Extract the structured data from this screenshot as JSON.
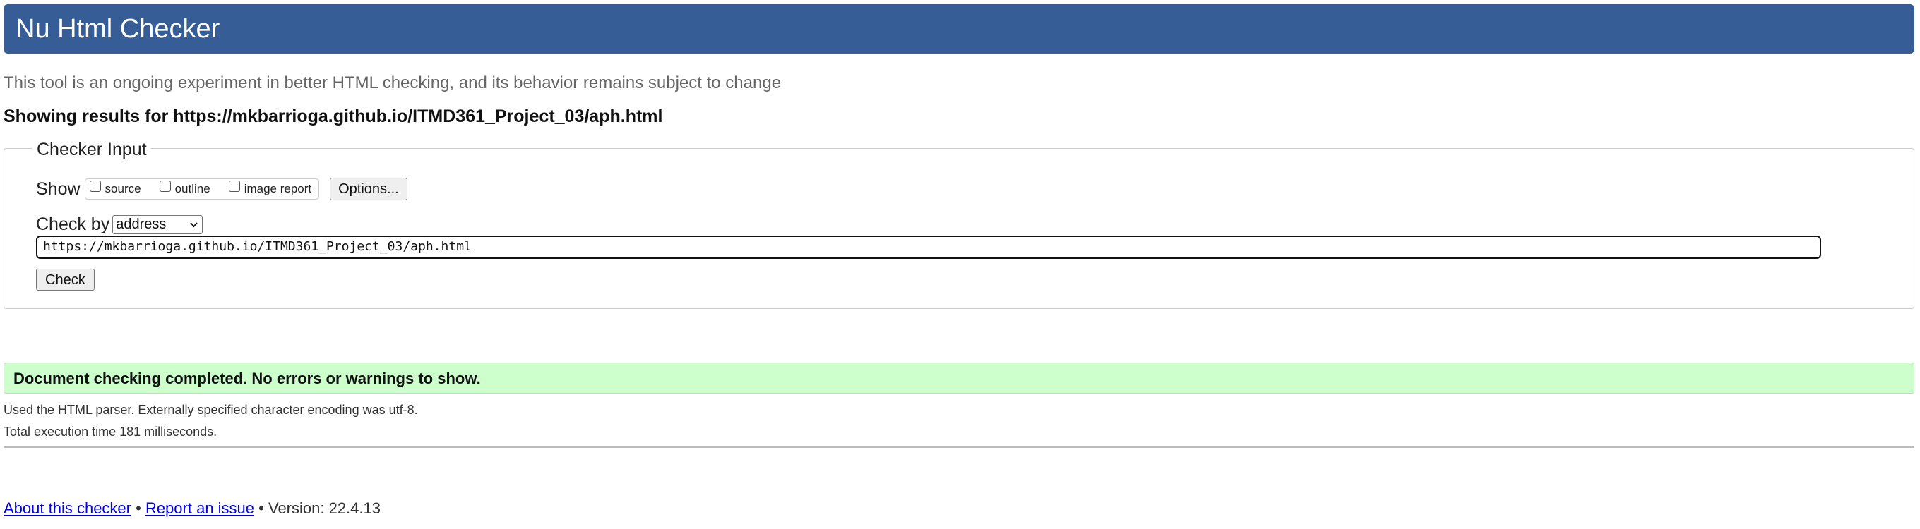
{
  "header": {
    "title": "Nu Html Checker"
  },
  "subtitle": "This tool is an ongoing experiment in better HTML checking, and its behavior remains subject to change",
  "results_for": "Showing results for https://mkbarrioga.github.io/ITMD361_Project_03/aph.html",
  "checker_input": {
    "legend": "Checker Input",
    "show_label": "Show",
    "show_options": [
      {
        "label": "source",
        "checked": false
      },
      {
        "label": "outline",
        "checked": false
      },
      {
        "label": "image report",
        "checked": false
      }
    ],
    "options_button": "Options...",
    "check_by_label": "Check by",
    "check_by_selected": "address",
    "url_value": "https://mkbarrioga.github.io/ITMD361_Project_03/aph.html",
    "check_button": "Check"
  },
  "result": {
    "message": "Document checking completed. No errors or warnings to show.",
    "parser_info": "Used the HTML parser. Externally specified character encoding was utf-8.",
    "execution_time": "Total execution time 181 milliseconds."
  },
  "footer": {
    "about_link": "About this checker",
    "separator": "•",
    "report_link": "Report an issue",
    "version": "Version: 22.4.13"
  },
  "colors": {
    "header_bg": "#365d95",
    "success_bg": "#ccffcc",
    "link": "#0000ee"
  }
}
